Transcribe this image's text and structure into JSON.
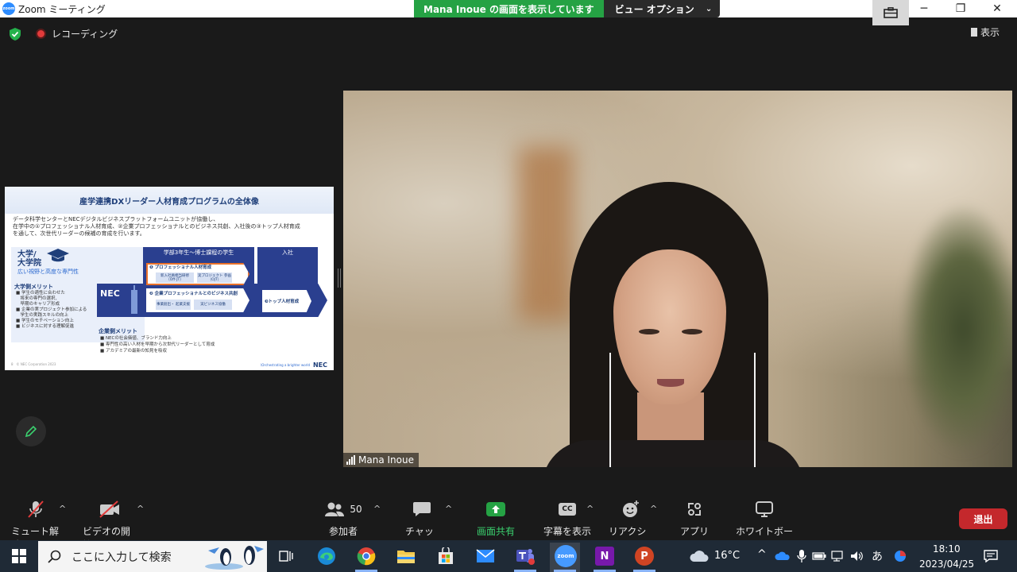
{
  "window": {
    "logo_text": "zoom",
    "title": "Zoom ミーティング",
    "minimize": "─",
    "restore": "❐",
    "close": "✕"
  },
  "share_banner": {
    "status": "Mana Inoue の画面を表示しています",
    "view_options": "ビュー オプション",
    "chevron": "⌄"
  },
  "status_row": {
    "recording_label": "レコーディング",
    "view_label": "表示"
  },
  "slide": {
    "title": "産学連携DXリーダー人材育成プログラムの全体像",
    "intro": "データ科学センターとNECデジタルビジネスプラットフォームユニットが協働し、\n在学中の①プロフェッショナル人材育成、②企業プロフェッショナルとのビジネス共創、入社後の③トップ人材育成\nを通して、次世代リーダーの候補の育成を行います。",
    "university": "大学/\n大学院",
    "university_sub": "広い視野と高度な専門性",
    "merit_title": "大学側メリット",
    "merit_items": "■ 学生の適性に合わせた\n　将来の専門の選択、\n　早期のキャリア形成\n■ 企業の実プロジェクト参加による\n　学生の実践スキルの向上\n■ 学生のモチベーション向上\n■ ビジネスに対する理解促進",
    "col_students": "学部3年生～博士課程の学生",
    "col_join": "入社",
    "nec": "NEC",
    "box1_title": "❶ プロフェッショナル人材育成",
    "chip1": "新入社員相当研修\n（Off-JT）",
    "chip2": "実プロジェクト\n参画（OJT）",
    "box2_title": "❷ 企業プロフェッショナルとのビジネス共創",
    "chip3": "事業創出・\n起業支援",
    "chip4": "実ビジネス協働",
    "box3_title": "❸トップ人材育成",
    "corp_title": "企業側メリット",
    "corp_items": "■ NECの社会価値、ブランド力向上\n■ 専門性の高い人材を早期から次世代リーダーとして育成\n■ アカデミアの最新の知見を吸収",
    "footer_left": "8　© NEC Corporation 2023",
    "footer_right": "\\Orchestrating a brighter world",
    "nec_logo": "NEC"
  },
  "video": {
    "participant_name": "Mana Inoue"
  },
  "toolbar": {
    "mute": "ミュート解除",
    "video": "ビデオの開始",
    "participants": "参加者",
    "participants_count": "50",
    "chat": "チャット",
    "share": "画面共有",
    "captions": "字幕を表示",
    "captions_icon": "CC",
    "reactions": "リアクション",
    "apps": "アプリ",
    "whiteboard": "ホワイトボード",
    "leave": "退出",
    "caret": "^"
  },
  "taskbar": {
    "search_placeholder": "ここに入力して検索",
    "weather": "16°C",
    "ime": "あ",
    "time": "18:10",
    "date": "2023/04/25",
    "zoom_label": "zoom",
    "onenote_label": "N",
    "ppt_label": "P"
  },
  "colors": {
    "accent_green": "#25a244",
    "leave_red": "#c4282c",
    "recording_red": "#e23b3b"
  }
}
